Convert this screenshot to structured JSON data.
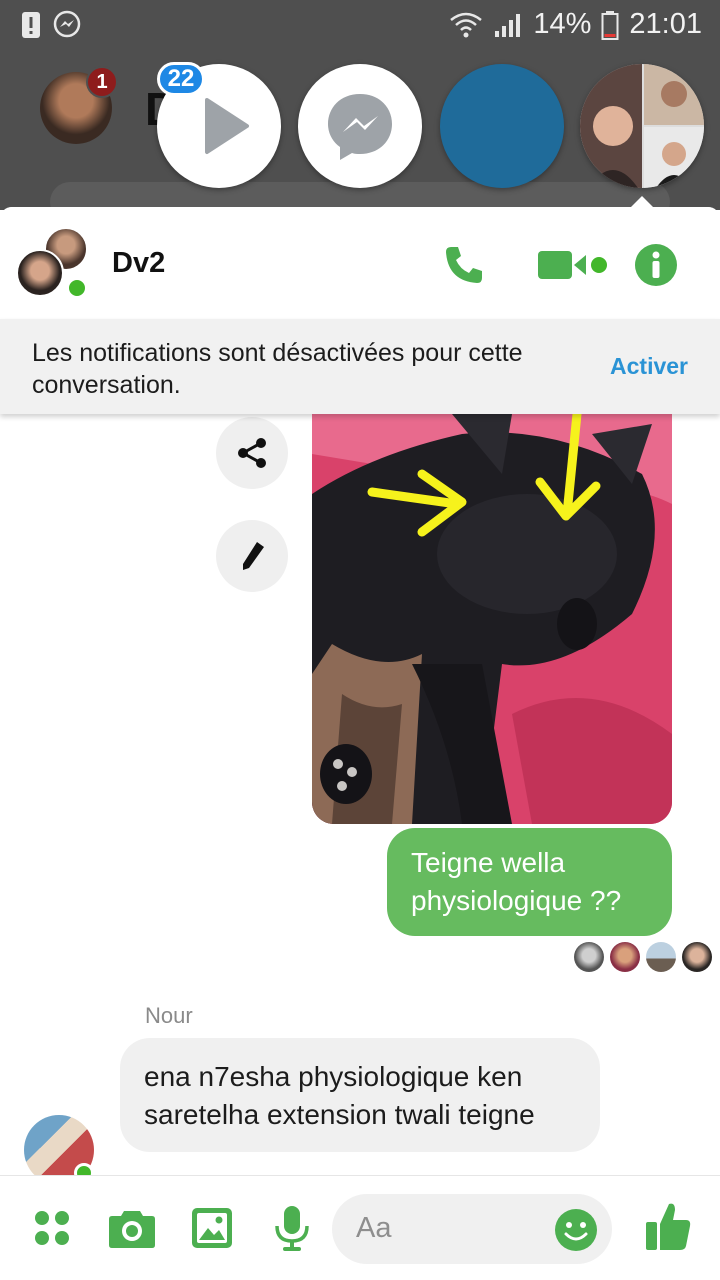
{
  "status_bar": {
    "battery": "14%",
    "time": "21:01"
  },
  "background_app": {
    "unread_count": "1",
    "title_partial": "D"
  },
  "chat_heads": {
    "badge_count": "22"
  },
  "conversation": {
    "name": "Dv2",
    "notice_text": "Les notifications sont désactivées pour cette conversation.",
    "notice_action": "Activer"
  },
  "messages": {
    "outgoing_text": "Teigne wella physiologique ??",
    "incoming_sender": "Nour",
    "incoming_text": "ena n7esha physiologique ken saretelha extension twali teigne"
  },
  "composer": {
    "placeholder": "Aa"
  },
  "colors": {
    "accent_green": "#4caf50",
    "bubble_green": "#66bb5f",
    "link_blue": "#2a93d5",
    "badge_blue": "#1e88e5"
  },
  "icons": {
    "header": [
      "phone-icon",
      "video-call-icon",
      "info-icon"
    ],
    "side_actions": [
      "share-icon",
      "edit-icon"
    ],
    "composer": [
      "more-apps-icon",
      "camera-icon",
      "gallery-icon",
      "microphone-icon",
      "emoji-icon",
      "thumbs-up-icon"
    ]
  }
}
